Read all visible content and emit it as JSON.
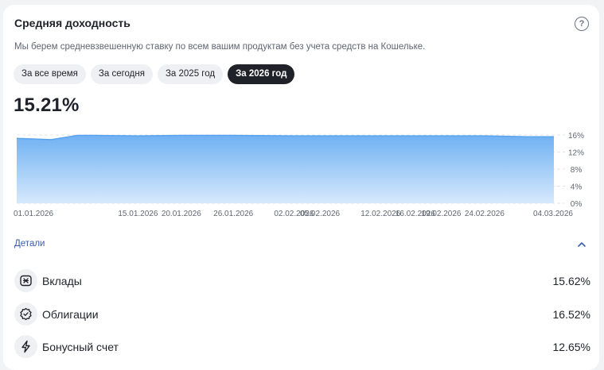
{
  "header": {
    "title": "Средняя доходность",
    "help_icon": "?",
    "subtitle": "Мы берем средневзвешенную ставку по всем вашим продуктам без учета средств на Кошельке."
  },
  "tabs": [
    {
      "label": "За все время",
      "active": false
    },
    {
      "label": "За сегодня",
      "active": false
    },
    {
      "label": "За 2025 год",
      "active": false
    },
    {
      "label": "За 2026 год",
      "active": true
    }
  ],
  "average_yield": "15.21%",
  "chart_data": {
    "type": "area",
    "x": [
      "01.01.2026",
      "05.01.2026",
      "08.01.2026",
      "10.01.2026",
      "15.01.2026",
      "20.01.2026",
      "26.01.2026",
      "02.02.2026",
      "05.02.2026",
      "12.02.2026",
      "16.02.2026",
      "19.02.2026",
      "24.02.2026",
      "01.03.2026",
      "04.03.2026"
    ],
    "values": [
      15.21,
      14.9,
      15.9,
      15.9,
      15.8,
      15.9,
      15.9,
      15.8,
      15.8,
      15.8,
      15.8,
      15.8,
      15.8,
      15.6,
      15.6
    ],
    "x_tick_labels": [
      "01.01.2026",
      "15.01.2026",
      "20.01.2026",
      "26.01.2026",
      "02.02.2026",
      "05.02.2026",
      "12.02.2026",
      "16.02.2026",
      "19.02.2026",
      "24.02.2026",
      "04.03.2026"
    ],
    "y_tick_labels": [
      "16%",
      "12%",
      "8%",
      "4%",
      "0%"
    ],
    "ylim": [
      0,
      16
    ],
    "grid": true,
    "fill_color": "#7fb9f4",
    "line_color": "#5aa4ef"
  },
  "details": {
    "label": "Детали",
    "items": [
      {
        "name": "Вклады",
        "value": "15.62%",
        "icon": "deposit-icon"
      },
      {
        "name": "Облигации",
        "value": "16.52%",
        "icon": "bond-icon"
      },
      {
        "name": "Бонусный счет",
        "value": "12.65%",
        "icon": "lightning-icon"
      }
    ]
  },
  "colors": {
    "accent_dark": "#1f2229",
    "link": "#3d5ba9"
  }
}
